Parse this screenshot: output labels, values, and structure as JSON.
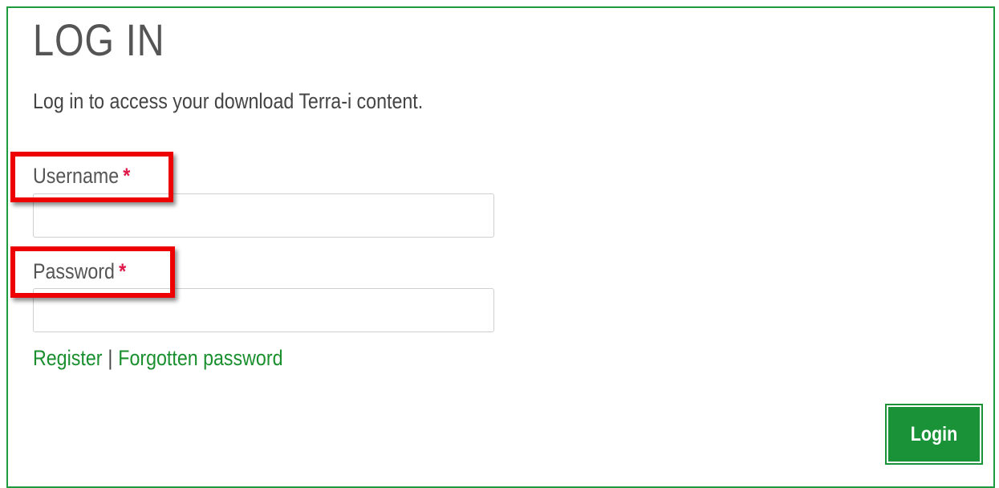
{
  "page": {
    "title": "LOG IN",
    "intro": "Log in to access your download Terra-i content."
  },
  "form": {
    "username": {
      "label": "Username",
      "required_marker": "*",
      "value": "",
      "placeholder": ""
    },
    "password": {
      "label": "Password",
      "required_marker": "*",
      "value": "",
      "placeholder": ""
    }
  },
  "links": {
    "register": "Register",
    "separator": "|",
    "forgot": "Forgotten password"
  },
  "buttons": {
    "login": "Login"
  },
  "colors": {
    "border": "#1e9b3c",
    "link": "#1a8f2e",
    "button": "#1a9338",
    "required": "#e0184a",
    "highlight": "#ee0000"
  }
}
